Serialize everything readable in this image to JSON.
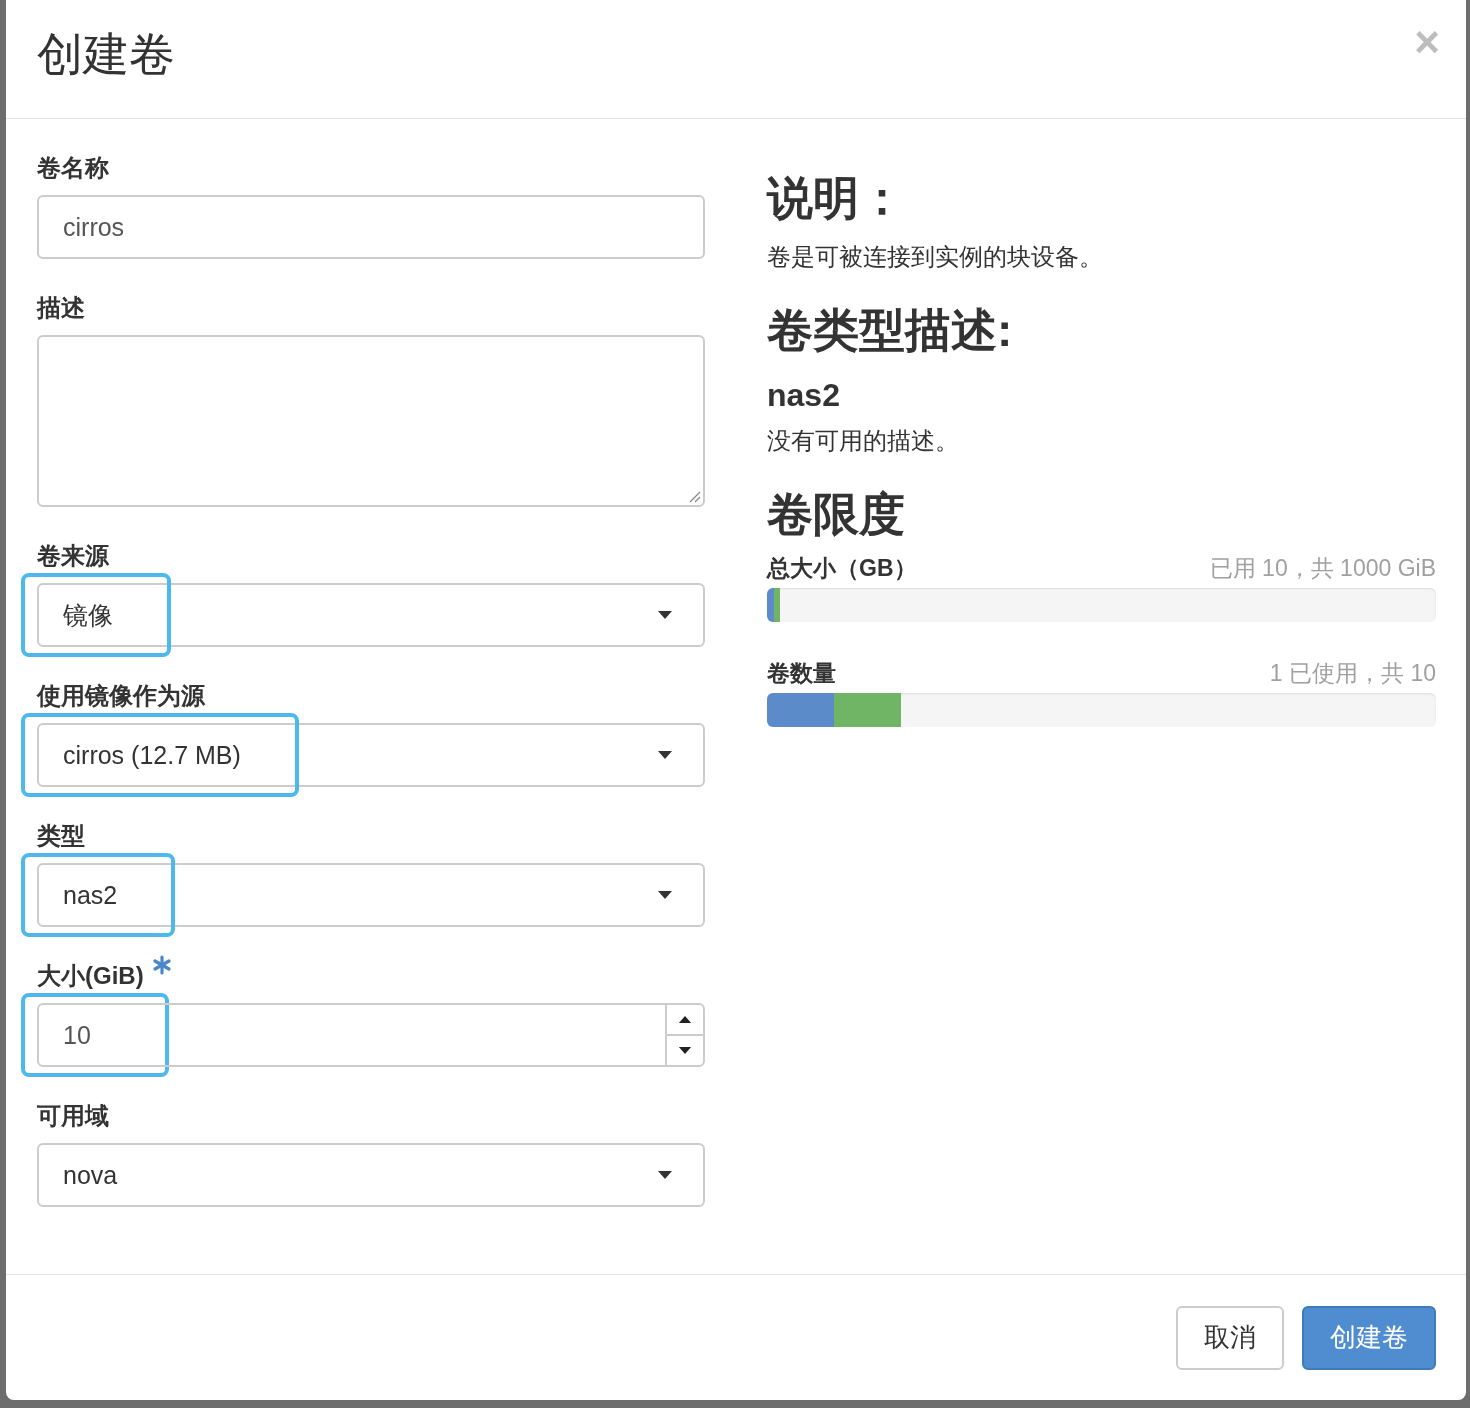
{
  "dialog": {
    "title": "创建卷",
    "close": "×"
  },
  "fields": [
    {
      "label": "卷名称",
      "kind": "text",
      "value": "cirros",
      "highlighted": false,
      "required": false
    },
    {
      "label": "描述",
      "kind": "textarea",
      "highlighted": false,
      "required": false
    },
    {
      "label": "卷来源",
      "kind": "select",
      "value": "镜像",
      "highlighted": true,
      "required": false
    },
    {
      "label": "使用镜像作为源",
      "kind": "select",
      "value": "cirros (12.7 MB)",
      "highlighted": true,
      "required": false
    },
    {
      "label": "类型",
      "kind": "select",
      "value": "nas2",
      "highlighted": true,
      "required": false
    },
    {
      "label": "大小(GiB)",
      "kind": "number",
      "value": "10",
      "highlighted": true,
      "required": true
    },
    {
      "label": "可用域",
      "kind": "select",
      "value": "nova",
      "highlighted": false,
      "required": false
    }
  ],
  "info": {
    "heading": "说明：",
    "text": "卷是可被连接到实例的块设备。",
    "type_heading": "卷类型描述:",
    "type_name": "nas2",
    "type_text": "没有可用的描述。",
    "limits_heading": "卷限度"
  },
  "limits": [
    {
      "label": "总大小（GB）",
      "reading": "已用 10，共 1000 GiB",
      "segments": [
        {
          "level": 0.01,
          "color": "#5b8bc9"
        },
        {
          "level": 0.01,
          "color": "#70b466"
        }
      ]
    },
    {
      "label": "卷数量",
      "reading": "1 已使用，共 10",
      "segments": [
        {
          "level": 0.1,
          "color": "#5b8bc9"
        },
        {
          "level": 0.1,
          "color": "#70b466"
        }
      ]
    }
  ],
  "buttons": [
    {
      "label": "取消",
      "kind": "default"
    },
    {
      "label": "创建卷",
      "kind": "primary"
    }
  ]
}
